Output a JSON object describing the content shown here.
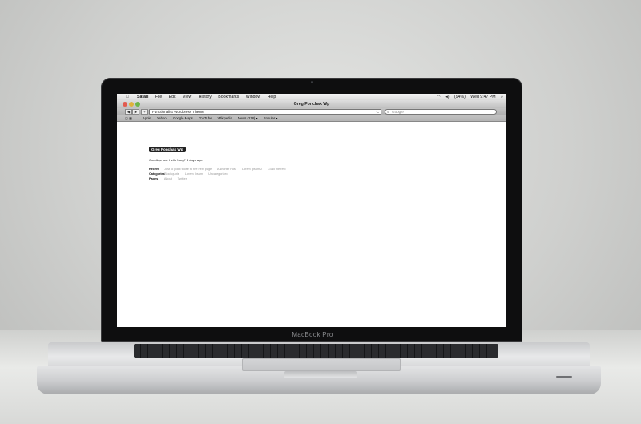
{
  "device": {
    "brand": "MacBook Pro"
  },
  "menubar": {
    "apple": "",
    "app_name": "Safari",
    "menus": [
      "File",
      "Edit",
      "View",
      "History",
      "Bookmarks",
      "Window",
      "Help"
    ],
    "battery": "(94%)",
    "clock": "Wed 9:47 PM"
  },
  "window": {
    "title": "Greg Ponchak Wp"
  },
  "toolbar": {
    "back": "◀",
    "forward": "▶",
    "add": "+",
    "url": "Functionalist Wordpress Theme",
    "reload": "C",
    "search_placeholder": "Google"
  },
  "bookmarks": {
    "items": [
      "Apple",
      "Yahoo!",
      "Google Maps",
      "YouTube",
      "Wikipedia",
      "News (218) ▾",
      "Popular ▾"
    ]
  },
  "page": {
    "site_title": "Greg Ponchak Wp",
    "post": {
      "prefix": "Goodbye cat.",
      "title": "Hello Xorg?",
      "age": "3 days ago"
    },
    "recent": {
      "label": "Recent",
      "links": [
        "Just to point those to the next page",
        "A shorter Post",
        "Lorem Ipsum 2",
        "Load the rest"
      ]
    },
    "categories": {
      "label": "Categories",
      "links": [
        "Blockquote",
        "Lorem Ipsum",
        "Uncategorized"
      ]
    },
    "pages": {
      "label": "Pages",
      "links": [
        "About",
        "Twitter"
      ]
    }
  }
}
